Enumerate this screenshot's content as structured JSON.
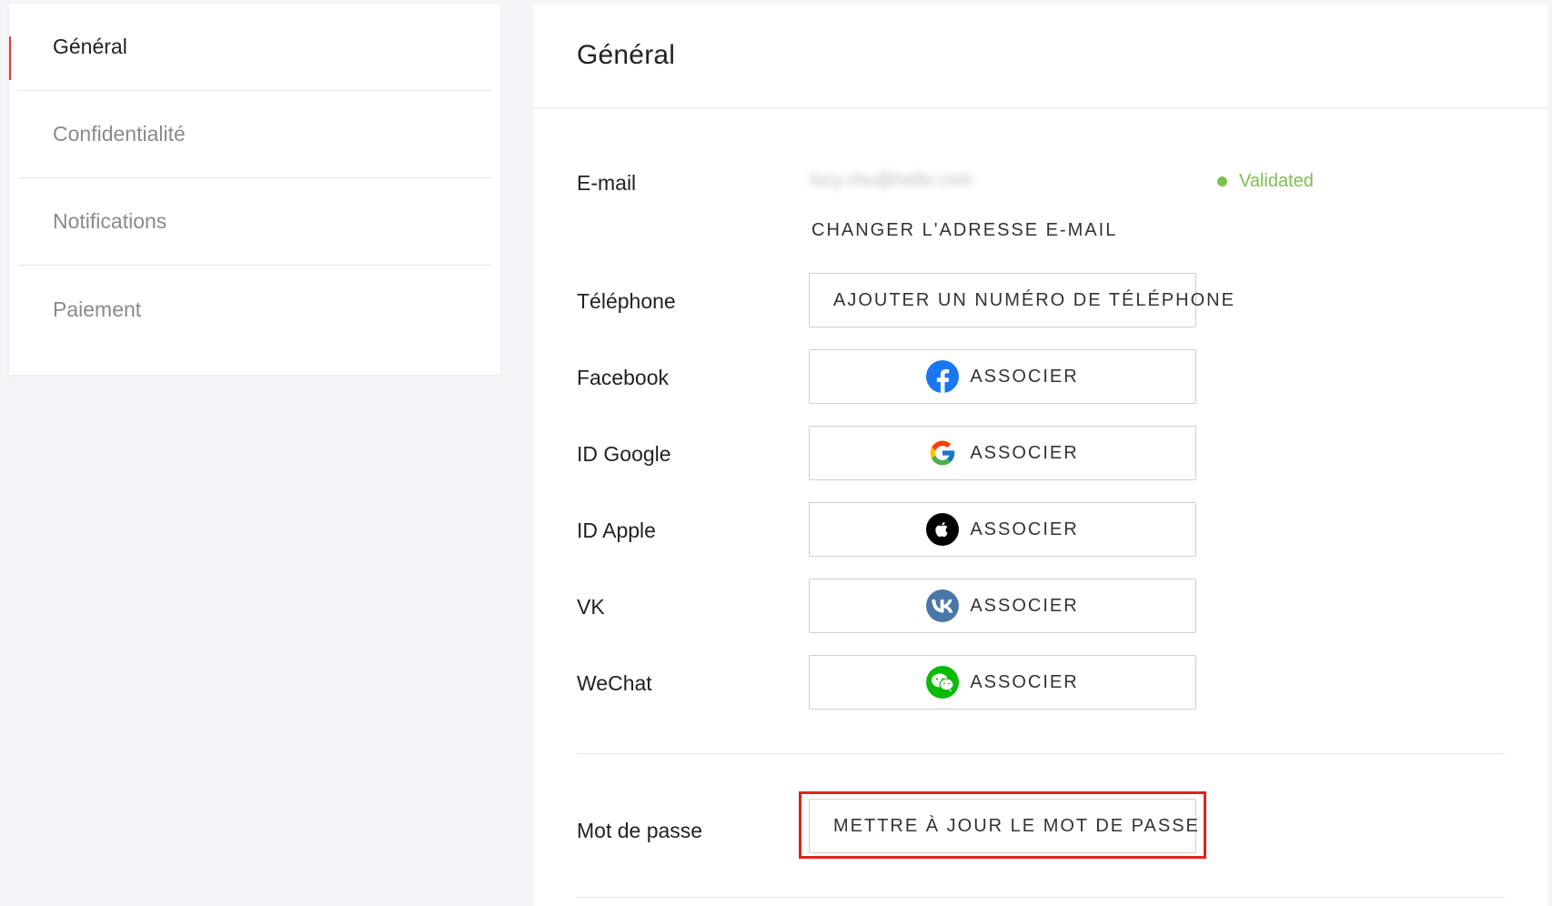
{
  "sidebar": {
    "items": [
      {
        "label": "Général",
        "active": true
      },
      {
        "label": "Confidentialité",
        "active": false
      },
      {
        "label": "Notifications",
        "active": false
      },
      {
        "label": "Paiement",
        "active": false
      }
    ]
  },
  "main": {
    "title": "Général",
    "email": {
      "label": "E-mail",
      "value": "lucy.chu@hello.com",
      "status": "Validated",
      "change_label": "CHANGER L'ADRESSE E-MAIL"
    },
    "phone": {
      "label": "Téléphone",
      "button": "AJOUTER UN NUMÉRO DE TÉLÉPHONE"
    },
    "facebook": {
      "label": "Facebook",
      "button": "ASSOCIER",
      "icon": "facebook-icon"
    },
    "google": {
      "label": "ID Google",
      "button": "ASSOCIER",
      "icon": "google-icon"
    },
    "apple": {
      "label": "ID Apple",
      "button": "ASSOCIER",
      "icon": "apple-icon"
    },
    "vk": {
      "label": "VK",
      "button": "ASSOCIER",
      "icon": "vk-icon"
    },
    "wechat": {
      "label": "WeChat",
      "button": "ASSOCIER",
      "icon": "wechat-icon"
    },
    "password": {
      "label": "Mot de passe",
      "button": "METTRE À JOUR LE MOT DE PASSE"
    }
  },
  "colors": {
    "accent": "#e53935",
    "validated": "#7cc04b",
    "highlight": "#e02419",
    "facebook": "#1877f2",
    "apple": "#000000",
    "vk": "#4a76a8",
    "wechat": "#09bb07"
  }
}
